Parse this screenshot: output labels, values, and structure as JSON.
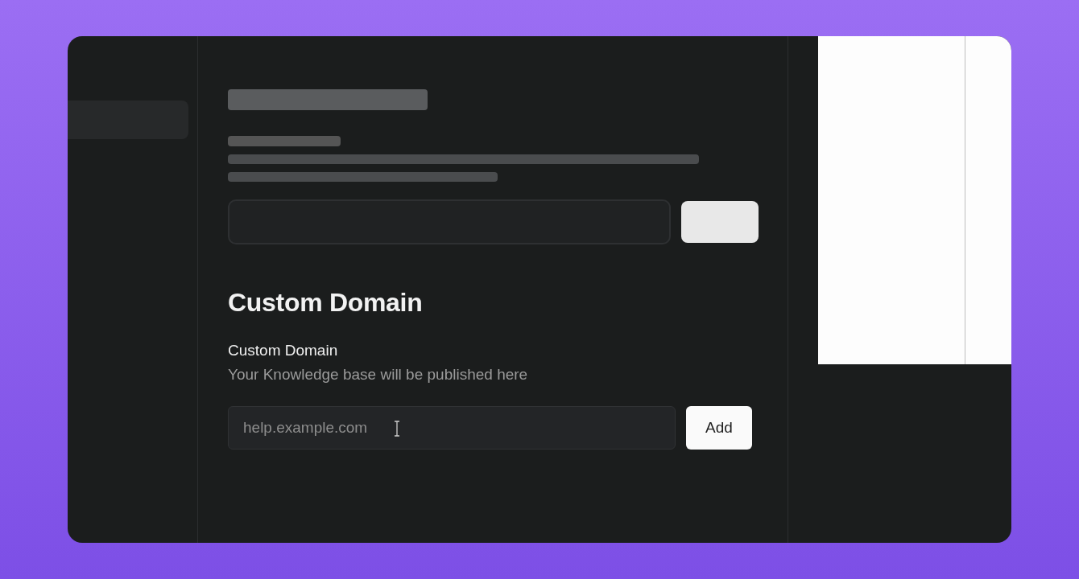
{
  "sidebar": {
    "items": [
      {
        "selected": true
      }
    ]
  },
  "sections": [
    {
      "kind": "blurred"
    },
    {
      "kind": "clear",
      "heading": "Custom Domain",
      "label": "Custom Domain",
      "description": "Your Knowledge base will be published here",
      "placeholder": "help.example.com",
      "button": "Add"
    }
  ]
}
